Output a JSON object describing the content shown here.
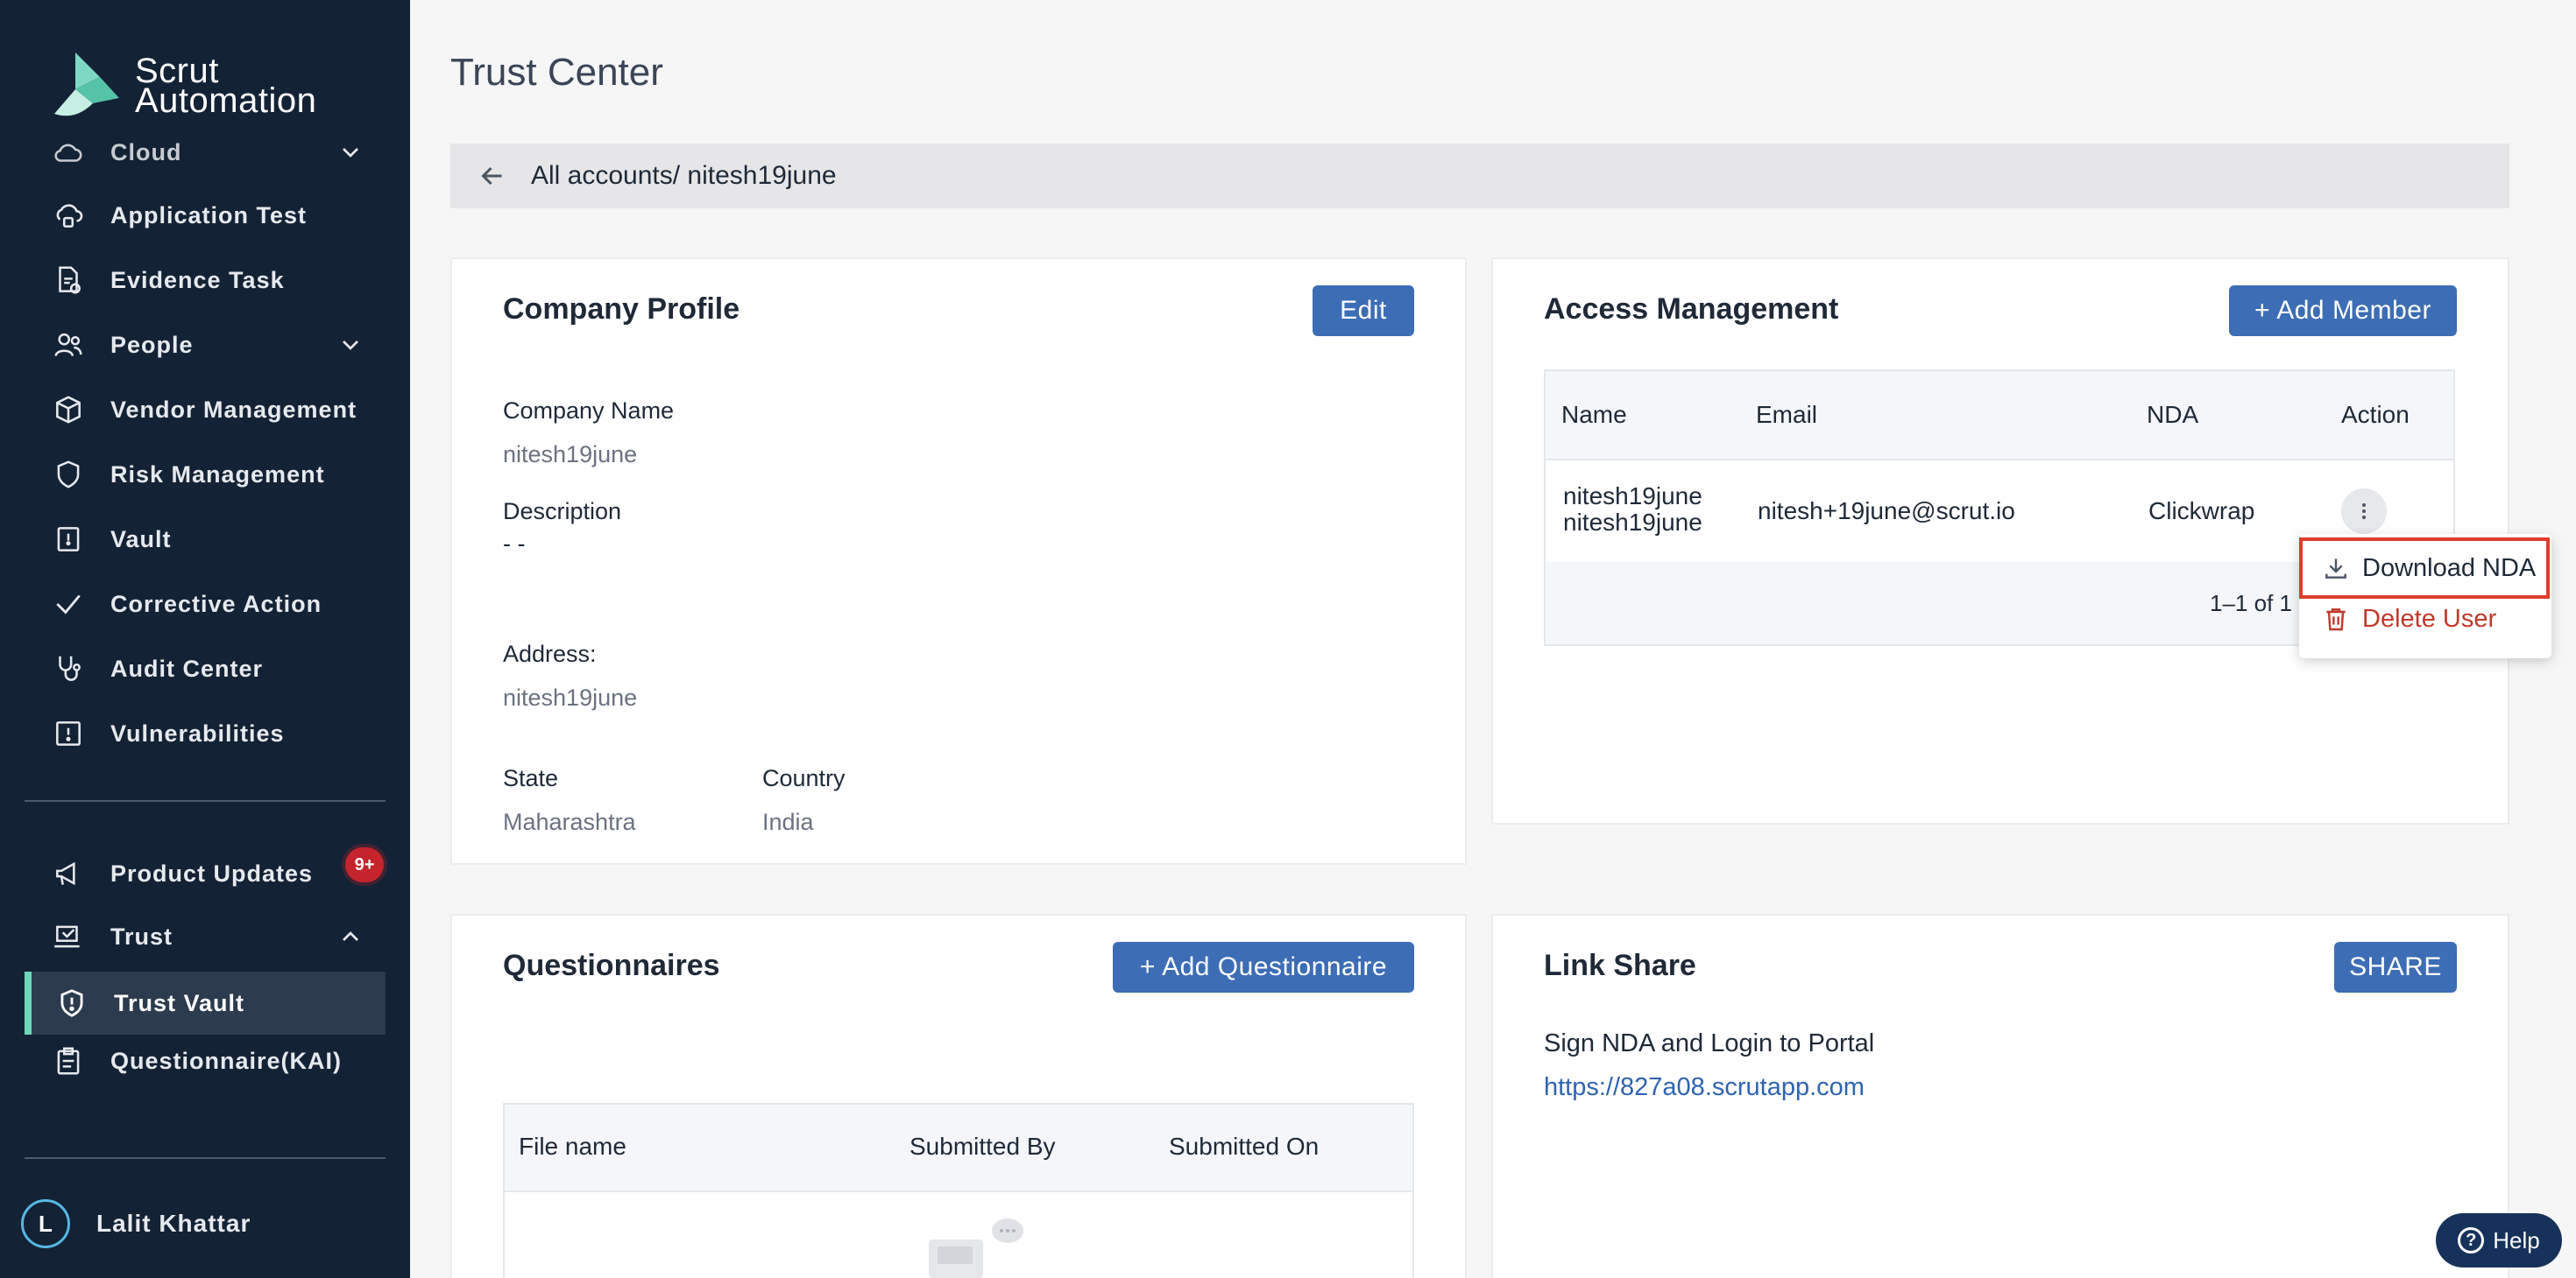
{
  "sidebar": {
    "brand_line1": "Scrut",
    "brand_line2": "Automation",
    "items": [
      {
        "label": "Cloud"
      },
      {
        "label": "Application Test"
      },
      {
        "label": "Evidence Task"
      },
      {
        "label": "People"
      },
      {
        "label": "Vendor Management"
      },
      {
        "label": "Risk Management"
      },
      {
        "label": "Vault"
      },
      {
        "label": "Corrective Action"
      },
      {
        "label": "Audit Center"
      },
      {
        "label": "Vulnerabilities"
      }
    ],
    "bottom_items": [
      {
        "label": "Product Updates"
      },
      {
        "label": "Trust"
      },
      {
        "label": "Trust Vault"
      },
      {
        "label": "Questionnaire(KAI)"
      }
    ],
    "badge": "9+",
    "user": {
      "initial": "L",
      "name": "Lalit Khattar"
    }
  },
  "header": {
    "title": "Trust Center",
    "breadcrumb": "All accounts/ nitesh19june"
  },
  "company_profile": {
    "title": "Company Profile",
    "edit_label": "Edit",
    "company_name_label": "Company Name",
    "company_name": "nitesh19june",
    "description_label": "Description",
    "description": "- -",
    "address_label": "Address:",
    "address": "nitesh19june",
    "state_label": "State",
    "state": "Maharashtra",
    "country_label": "Country",
    "country": "India"
  },
  "access_management": {
    "title": "Access Management",
    "add_member_label": "+ Add Member",
    "columns": [
      "Name",
      "Email",
      "NDA",
      "Action"
    ],
    "rows": [
      {
        "name_line1": "nitesh19june",
        "name_line2": "nitesh19june",
        "email": "nitesh+19june@scrut.io",
        "nda": "Clickwrap"
      }
    ],
    "pagination": "1–1 of 1"
  },
  "action_menu": {
    "download_label": "Download NDA",
    "delete_label": "Delete User"
  },
  "questionnaires": {
    "title": "Questionnaires",
    "add_label": "+ Add Questionnaire",
    "columns": [
      "File name",
      "Submitted By",
      "Submitted On"
    ]
  },
  "link_share": {
    "title": "Link Share",
    "share_label": "SHARE",
    "text": "Sign NDA and Login to Portal",
    "url": "https://827a08.scrutapp.com"
  },
  "help": {
    "label": "Help"
  },
  "colors": {
    "sidebar": "#142235",
    "accent": "#3d6db5",
    "active_bar": "#6fd6bb",
    "danger": "#c0392b",
    "link": "#2f63b3"
  }
}
